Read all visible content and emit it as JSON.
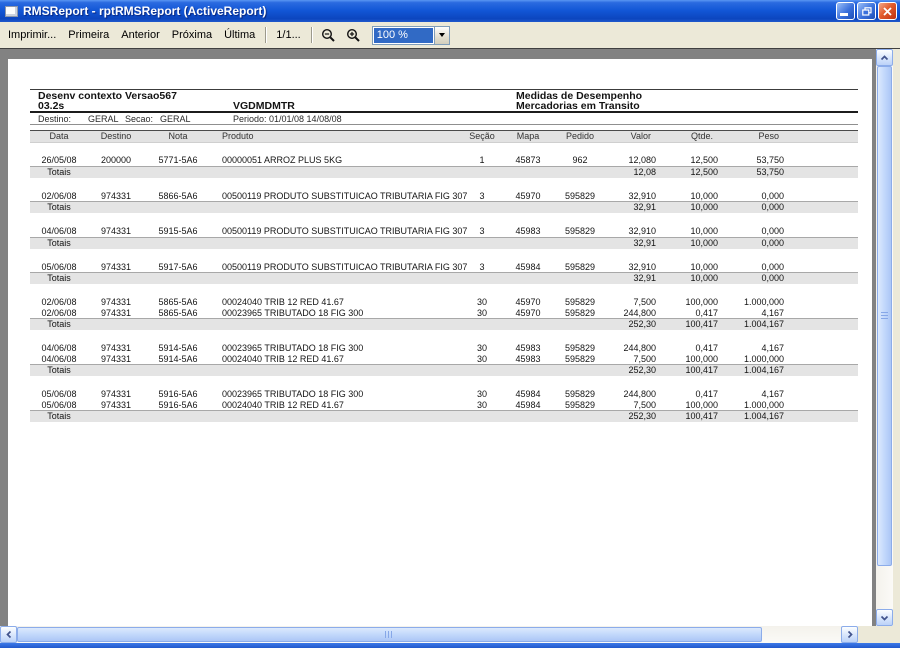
{
  "window": {
    "title": "RMSReport - rptRMSReport (ActiveReport)"
  },
  "toolbar": {
    "print_label": "Imprimir...",
    "first_label": "Primeira",
    "prev_label": "Anterior",
    "next_label": "Próxima",
    "last_label": "Última",
    "page_indicator": "1/1...",
    "zoom_value": "100 %"
  },
  "icons": {
    "app_icon": "document-window",
    "minimize_icon": "minimize-bar",
    "restore_icon": "overlapping-windows",
    "close_icon": "x-cross",
    "zoom_out_icon": "magnifier-minus",
    "zoom_in_icon": "magnifier-plus",
    "combo_dropdown_icon": "triangle-down",
    "scroll_up_icon": "chevron-up",
    "scroll_down_icon": "chevron-down",
    "scroll_left_icon": "chevron-left",
    "scroll_right_icon": "chevron-right"
  },
  "colors": {
    "titlebar_blue": "#1256d6",
    "toolbar_bg": "#ece9d8",
    "viewport_gray": "#828282",
    "selection_blue": "#316ac5",
    "band_gray": "#e2e2e2",
    "close_red": "#c03010"
  },
  "report": {
    "header": {
      "line1_left": "Desenv contexto Versao567",
      "line1_right": "Medidas de Desempenho",
      "line2_left": "03.2s",
      "line2_mid": "VGDMDMTR",
      "line2_right": "Mercadorias em Transito",
      "destino_label": "Destino:",
      "destino_value": "GERAL",
      "secao_label": "Secao:",
      "secao_value": "GERAL",
      "periodo": "Periodo: 01/01/08 14/08/08"
    },
    "columns": [
      "Data",
      "Destino",
      "Nota",
      "Produto",
      "Seção",
      "Mapa",
      "Pedido",
      "Valor",
      "Qtde.",
      "Peso"
    ],
    "totais_label": "Totais",
    "groups": [
      {
        "rows": [
          [
            "26/05/08",
            "200000",
            "5771-5A6",
            "00000051 ARROZ PLUS 5KG",
            "1",
            "45873",
            "962",
            "12,080",
            "12,500",
            "53,750"
          ]
        ],
        "totals": [
          "12,08",
          "12,500",
          "53,750"
        ]
      },
      {
        "rows": [
          [
            "02/06/08",
            "974331",
            "5866-5A6",
            "00500119 PRODUTO SUBSTITUICAO TRIBUTARIA FIG 307",
            "3",
            "45970",
            "595829",
            "32,910",
            "10,000",
            "0,000"
          ]
        ],
        "totals": [
          "32,91",
          "10,000",
          "0,000"
        ]
      },
      {
        "rows": [
          [
            "04/06/08",
            "974331",
            "5915-5A6",
            "00500119 PRODUTO SUBSTITUICAO TRIBUTARIA FIG 307",
            "3",
            "45983",
            "595829",
            "32,910",
            "10,000",
            "0,000"
          ]
        ],
        "totals": [
          "32,91",
          "10,000",
          "0,000"
        ]
      },
      {
        "rows": [
          [
            "05/06/08",
            "974331",
            "5917-5A6",
            "00500119 PRODUTO SUBSTITUICAO TRIBUTARIA FIG 307",
            "3",
            "45984",
            "595829",
            "32,910",
            "10,000",
            "0,000"
          ]
        ],
        "totals": [
          "32,91",
          "10,000",
          "0,000"
        ]
      },
      {
        "rows": [
          [
            "02/06/08",
            "974331",
            "5865-5A6",
            "00024040 TRIB 12 RED 41.67",
            "30",
            "45970",
            "595829",
            "7,500",
            "100,000",
            "1.000,000"
          ],
          [
            "02/06/08",
            "974331",
            "5865-5A6",
            "00023965 TRIBUTADO 18 FIG 300",
            "30",
            "45970",
            "595829",
            "244,800",
            "0,417",
            "4,167"
          ]
        ],
        "totals": [
          "252,30",
          "100,417",
          "1.004,167"
        ]
      },
      {
        "rows": [
          [
            "04/06/08",
            "974331",
            "5914-5A6",
            "00023965 TRIBUTADO 18 FIG 300",
            "30",
            "45983",
            "595829",
            "244,800",
            "0,417",
            "4,167"
          ],
          [
            "04/06/08",
            "974331",
            "5914-5A6",
            "00024040 TRIB 12 RED 41.67",
            "30",
            "45983",
            "595829",
            "7,500",
            "100,000",
            "1.000,000"
          ]
        ],
        "totals": [
          "252,30",
          "100,417",
          "1.004,167"
        ]
      },
      {
        "rows": [
          [
            "05/06/08",
            "974331",
            "5916-5A6",
            "00023965 TRIBUTADO 18 FIG 300",
            "30",
            "45984",
            "595829",
            "244,800",
            "0,417",
            "4,167"
          ],
          [
            "05/06/08",
            "974331",
            "5916-5A6",
            "00024040 TRIB 12 RED 41.67",
            "30",
            "45984",
            "595829",
            "7,500",
            "100,000",
            "1.000,000"
          ]
        ],
        "totals": [
          "252,30",
          "100,417",
          "1.004,167"
        ]
      }
    ]
  }
}
